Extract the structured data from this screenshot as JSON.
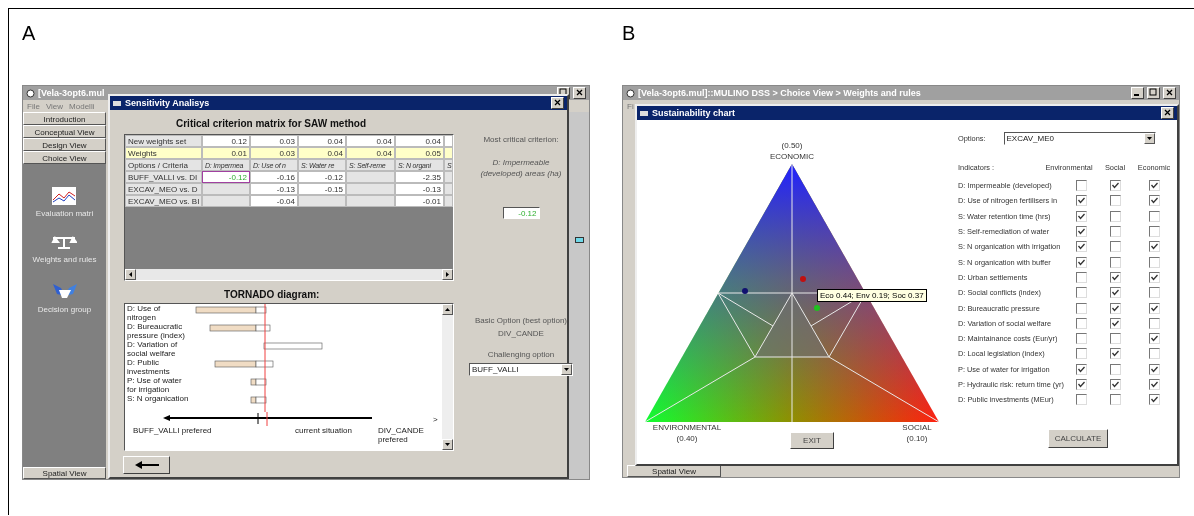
{
  "panel_a": {
    "label": "A",
    "window": {
      "title": "[Vela-3opt6.mul",
      "menu": [
        "File",
        "View",
        "Modelli"
      ],
      "nav_tabs": [
        "Introduction",
        "Conceptual View",
        "Design View",
        "Choice View"
      ],
      "tools": [
        {
          "kind": "chart",
          "label": "Evaluation matri"
        },
        {
          "kind": "scale",
          "label": "Weights and rules"
        },
        {
          "kind": "handshake",
          "label": "Decision group"
        }
      ],
      "bottom_tab": "Spatial View"
    },
    "dialog": {
      "title": "Sensitivity Analisys",
      "matrix_title": "Critical criterion matrix for SAW method",
      "matrix": [
        {
          "kind": "new_weights",
          "label": "New weights set",
          "cells": [
            {
              "text": "0.12",
              "selected": false
            },
            {
              "text": "0.03",
              "selected": false
            },
            {
              "text": "0.04",
              "selected": false
            },
            {
              "text": "0.04",
              "selected": false
            },
            {
              "text": "0.04",
              "selected": false
            },
            {
              "selected": false
            }
          ]
        },
        {
          "kind": "weights",
          "label": "Weights",
          "cells": [
            {
              "text": "0.01",
              "selected": false
            },
            {
              "text": "0.03",
              "selected": false
            },
            {
              "text": "0.04",
              "selected": false
            },
            {
              "text": "0.04",
              "selected": false
            },
            {
              "text": "0.05",
              "selected": false
            },
            {
              "selected": false
            }
          ]
        },
        {
          "kind": "header",
          "label": "Options / Criteria",
          "cells": [
            {
              "text": "D: Impermea",
              "selected": false
            },
            {
              "text": "D: Use of n",
              "selected": false
            },
            {
              "text": "S: Water re",
              "selected": false
            },
            {
              "text": "S: Self-reme",
              "selected": false
            },
            {
              "text": "S: N organi",
              "selected": false
            },
            {
              "text": "S",
              "selected": false
            }
          ]
        },
        {
          "kind": "comparison",
          "label": "BUFF_VALLI vs. DI",
          "cells": [
            {
              "text": "-0.12",
              "selected": true
            },
            {
              "text": "-0.16",
              "selected": false
            },
            {
              "text": "-0.12",
              "selected": false
            },
            {
              "selected": false
            },
            {
              "text": "-2.35",
              "selected": false
            },
            {
              "selected": false
            }
          ]
        },
        {
          "kind": "comparison",
          "label": "EXCAV_MEO vs. D",
          "cells": [
            {
              "selected": false
            },
            {
              "text": "-0.13",
              "selected": false
            },
            {
              "text": "-0.15",
              "selected": false
            },
            {
              "selected": false
            },
            {
              "text": "-0.13",
              "selected": false
            },
            {
              "selected": false
            }
          ]
        },
        {
          "kind": "comparison",
          "label": "EXCAV_MEO vs. BI",
          "cells": [
            {
              "selected": false
            },
            {
              "text": "-0.04",
              "selected": false
            },
            {
              "selected": false
            },
            {
              "selected": false
            },
            {
              "text": "-0.01",
              "selected": false
            },
            {
              "selected": false
            }
          ]
        }
      ],
      "critical_label": "Most critical criterion:",
      "critical_criterion": "D: Impermeable (developed) areas (ha)",
      "critical_value": "-0.12",
      "tornado_title": "TORNADO diagram:",
      "tornado": {
        "rows": [
          "D: Use of nitrogen",
          "D: Bureaucratic pressure (index)",
          "D: Variation of social welfare",
          "D: Public investments",
          "P: Use of water for irrigation",
          "S: N organication"
        ],
        "more": ">",
        "left_label": "BUFF_VALLI prefered",
        "center_label": "current situation",
        "right_label": "DIV_CANDE prefered"
      },
      "basic_option_label": "Basic Option (best option)",
      "basic_option": "DIV_CANDE",
      "challenging_label": "Challenging option",
      "challenging_option": "BUFF_VALLI"
    }
  },
  "panel_b": {
    "label": "B",
    "window": {
      "title": "[Vela-3opt6.mul]::MULINO DSS > Choice View > Weights and rules",
      "menu": [
        "Fi"
      ],
      "bottom_tab": "Spatial View"
    },
    "dialog": {
      "title": "Sustainability chart",
      "chart": {
        "top_value": "(0.50)",
        "top_label": "ECONOMIC",
        "left_label": "ENVIRONMENTAL",
        "left_value": "(0.40)",
        "right_label": "SOCIAL",
        "right_value": "(0.10)",
        "points": [
          {
            "color": "#101070"
          },
          {
            "color": "#c01010"
          },
          {
            "color": "#20c020"
          }
        ],
        "tooltip": "Eco 0.44; Env 0.19; Soc 0.37"
      },
      "exit_button": "EXIT",
      "options_label": "Options:",
      "option": "EXCAV_ME0",
      "indicators_label": "Indicators :",
      "columns": [
        "Environmental",
        "Social",
        "Economic"
      ],
      "indicators": [
        {
          "name": "D: Impermeable (developed)",
          "environmental": false,
          "social": true,
          "economic": true
        },
        {
          "name": "D: Use of nitrogen fertilisers in",
          "environmental": true,
          "social": false,
          "economic": true
        },
        {
          "name": "S: Water retention time (hrs)",
          "environmental": true,
          "social": false,
          "economic": false
        },
        {
          "name": "S: Self-remediation of water",
          "environmental": true,
          "social": false,
          "economic": false
        },
        {
          "name": "S: N organication with irrigation",
          "environmental": true,
          "social": false,
          "economic": true
        },
        {
          "name": "S: N organication with buffer",
          "environmental": true,
          "social": false,
          "economic": false
        },
        {
          "name": "D: Urban settlements",
          "environmental": false,
          "social": true,
          "economic": true
        },
        {
          "name": "D: Social conflicts (index)",
          "environmental": false,
          "social": true,
          "economic": false
        },
        {
          "name": "D: Bureaucratic pressure",
          "environmental": false,
          "social": true,
          "economic": true
        },
        {
          "name": "D: Variation of social welfare",
          "environmental": false,
          "social": true,
          "economic": false
        },
        {
          "name": "D: Maintainance costs (Eur/yr)",
          "environmental": false,
          "social": false,
          "economic": true
        },
        {
          "name": "D: Local legislation (index)",
          "environmental": false,
          "social": true,
          "economic": false
        },
        {
          "name": "P: Use of water for irrigation",
          "environmental": true,
          "social": false,
          "economic": true
        },
        {
          "name": "P: Hydraulic risk: return time (yr)",
          "environmental": true,
          "social": true,
          "economic": true
        },
        {
          "name": "D: Public investments (MEur)",
          "environmental": false,
          "social": false,
          "economic": true
        }
      ],
      "calculate_button": "CALCULATE"
    }
  }
}
